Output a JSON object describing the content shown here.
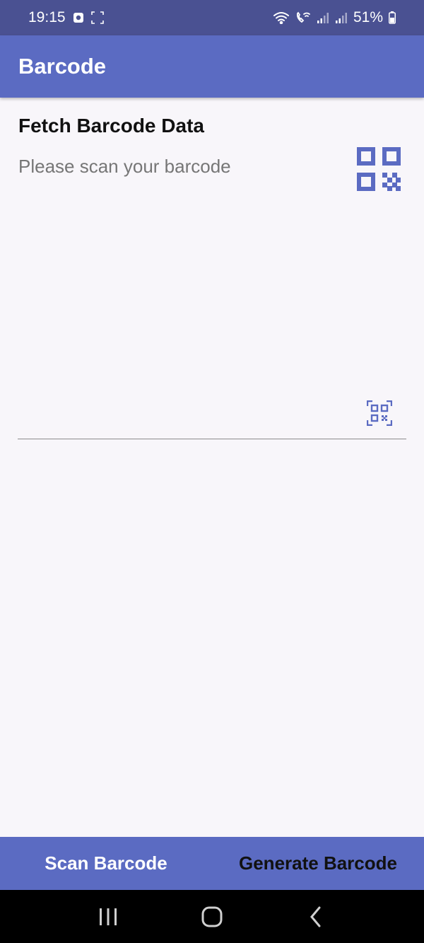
{
  "status_bar": {
    "time": "19:15",
    "battery": "51%",
    "icons": [
      "notification-icon",
      "screenshot-icon",
      "wifi-icon",
      "wifi-call-icon",
      "signal-icon",
      "signal-icon",
      "battery-icon"
    ]
  },
  "app_bar": {
    "title": "Barcode"
  },
  "main": {
    "section_title": "Fetch Barcode Data",
    "subtitle": "Please scan your barcode",
    "input_value": ""
  },
  "bottom_tabs": [
    {
      "label": "Scan Barcode",
      "active": true
    },
    {
      "label": "Generate Barcode",
      "active": false
    }
  ],
  "nav_bar": {
    "icons": [
      "recent-apps-icon",
      "home-icon",
      "back-icon"
    ]
  },
  "colors": {
    "primary": "#5b6bc2",
    "status_bar": "#4a5192",
    "background": "#f8f6fa"
  }
}
